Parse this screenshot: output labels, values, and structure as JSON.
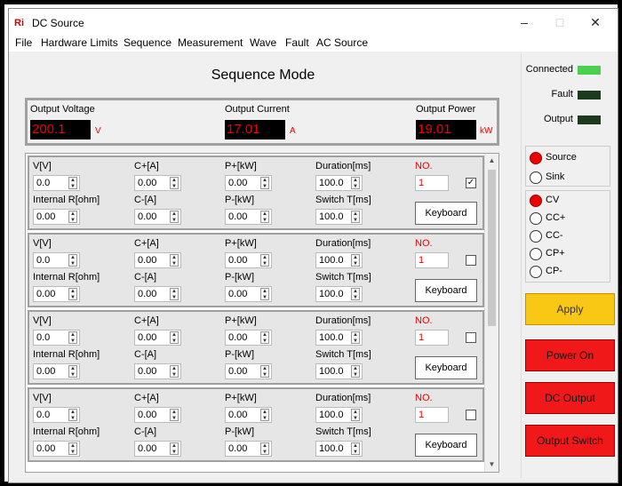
{
  "window": {
    "title": "DC Source",
    "logo": "Ri",
    "controls": {
      "minimize": "–",
      "maximize": "□",
      "close": "✕"
    }
  },
  "menu": [
    "File",
    "Hardware Limits",
    "Sequence",
    "Measurement",
    "Wave",
    "Fault",
    "AC Source"
  ],
  "page_title": "Sequence Mode",
  "outputs": {
    "voltage": {
      "label": "Output Voltage",
      "value": "200.1",
      "unit": "V"
    },
    "current": {
      "label": "Output Current",
      "value": "17.01",
      "unit": "A"
    },
    "power": {
      "label": "Output Power",
      "value": "19.01",
      "unit": "kW"
    }
  },
  "labels": {
    "v": "V[V]",
    "cplus": "C+[A]",
    "pplus": "P+[kW]",
    "duration": "Duration[ms]",
    "no": "NO.",
    "intr": "Internal R[ohm]",
    "cminus": "C-[A]",
    "pminus": "P-[kW]",
    "switch": "Switch T[ms]",
    "keyboard": "Keyboard"
  },
  "sequences": [
    {
      "v": "0.0",
      "cplus": "0.00",
      "pplus": "0.00",
      "duration": "100.0",
      "no": "1",
      "checked": "✓",
      "intr": "0.00",
      "cminus": "0.00",
      "pminus": "0.00",
      "switch": "100.0"
    },
    {
      "v": "0.0",
      "cplus": "0.00",
      "pplus": "0.00",
      "duration": "100.0",
      "no": "1",
      "checked": "",
      "intr": "0.00",
      "cminus": "0.00",
      "pminus": "0.00",
      "switch": "100.0"
    },
    {
      "v": "0.0",
      "cplus": "0.00",
      "pplus": "0.00",
      "duration": "100.0",
      "no": "1",
      "checked": "",
      "intr": "0.00",
      "cminus": "0.00",
      "pminus": "0.00",
      "switch": "100.0"
    },
    {
      "v": "0.0",
      "cplus": "0.00",
      "pplus": "0.00",
      "duration": "100.0",
      "no": "1",
      "checked": "",
      "intr": "0.00",
      "cminus": "0.00",
      "pminus": "0.00",
      "switch": "100.0"
    }
  ],
  "status": {
    "connected": {
      "label": "Connected",
      "color": "#4cd04c"
    },
    "fault": {
      "label": "Fault",
      "color": "#1c3a1c"
    },
    "output": {
      "label": "Output",
      "color": "#1c3a1c"
    }
  },
  "direction": {
    "options": [
      "Source",
      "Sink"
    ],
    "selected": "Source"
  },
  "mode": {
    "options": [
      "CV",
      "CC+",
      "CC-",
      "CP+",
      "CP-"
    ],
    "selected": "CV"
  },
  "buttons": {
    "apply": "Apply",
    "power_on": "Power On",
    "dc_output": "DC Output",
    "output_switch": "Output Switch"
  },
  "colors": {
    "apply": "#f8c814",
    "danger": "#f01818",
    "readout_text": "#e00000"
  }
}
